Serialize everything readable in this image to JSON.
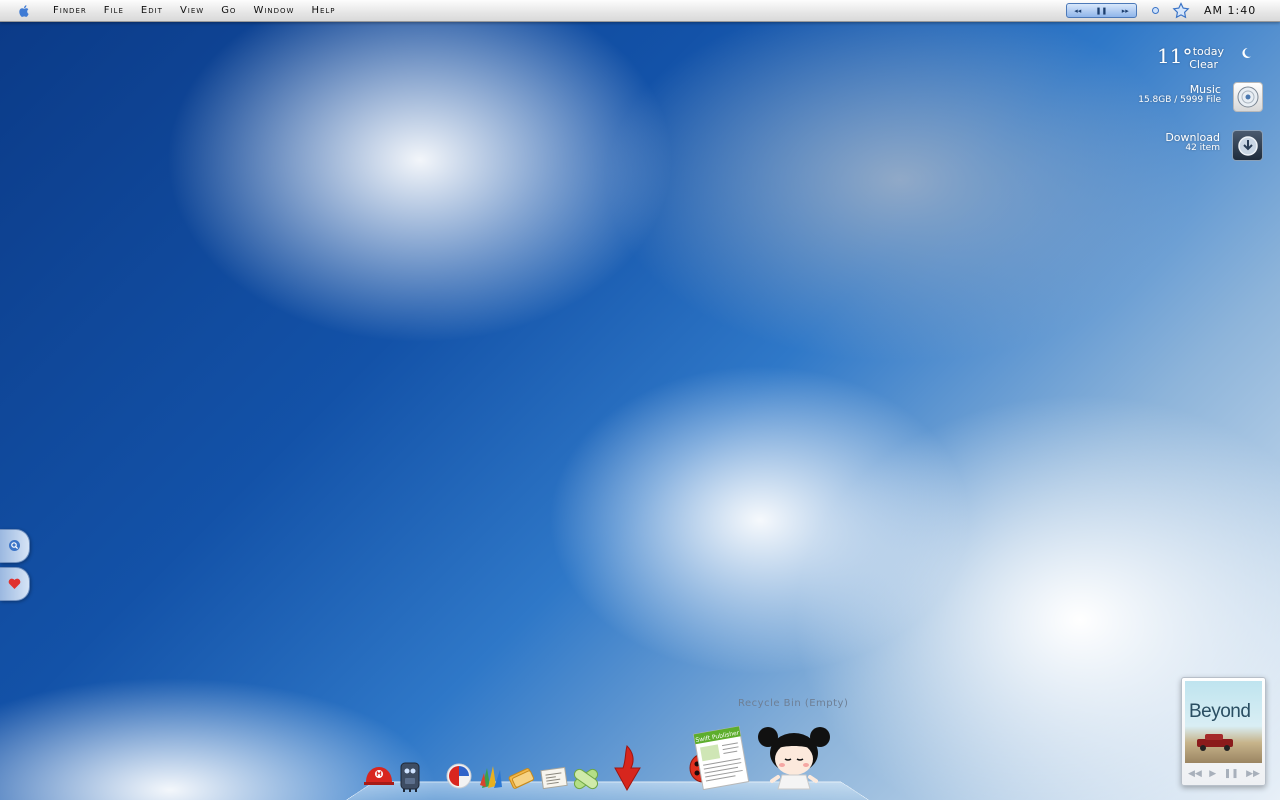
{
  "menubar": {
    "items": [
      "Finder",
      "File",
      "Edit",
      "View",
      "Go",
      "Window",
      "Help"
    ],
    "media": {
      "prev": "◂◂",
      "pause": "❚❚",
      "next": "▸▸"
    },
    "clock": "AM 1:40"
  },
  "weather": {
    "temp": "11°",
    "day": "today",
    "condition": "Clear"
  },
  "music": {
    "label": "Music",
    "stats": "15.8GB / 5999 File"
  },
  "download": {
    "label": "Download",
    "stats": "42  item"
  },
  "dock": {
    "recycle_label": "Recycle Bin (Empty)",
    "publisher_label": "Swift Publisher"
  },
  "album": {
    "title": "Beyond",
    "controls": {
      "prev": "◀◀",
      "play": "▶",
      "pause": "❚❚",
      "next": "▶▶"
    }
  },
  "colors": {
    "accent": "#3b74c7",
    "menubar": "#e6e6e6"
  }
}
